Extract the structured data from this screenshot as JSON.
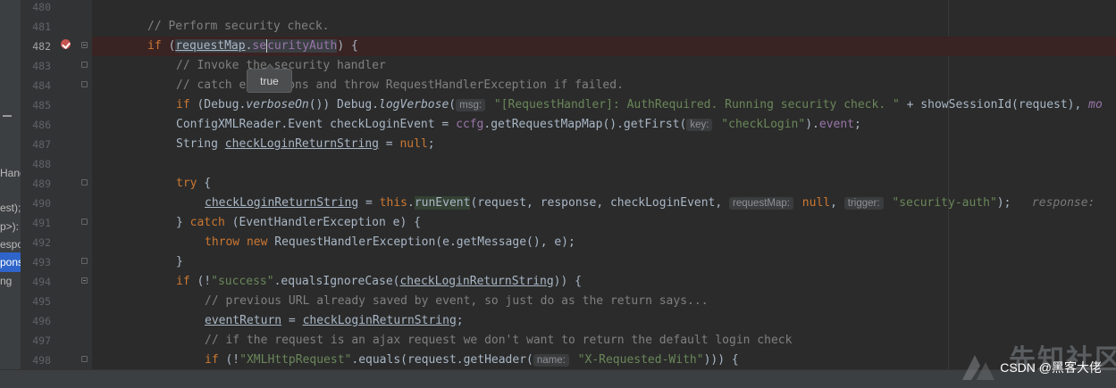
{
  "side_panel": {
    "items": [
      {
        "text": "Hand",
        "selected": false
      },
      {
        "text": "est);",
        "selected": false
      },
      {
        "text": "p>):",
        "selected": false
      },
      {
        "text": "espo",
        "selected": false
      },
      {
        "text": "pons",
        "selected": true
      },
      {
        "text": "ng",
        "selected": false
      }
    ]
  },
  "gutter": {
    "line_numbers": [
      "480",
      "481",
      "482",
      "483",
      "484",
      "485",
      "486",
      "487",
      "488",
      "489",
      "490",
      "491",
      "492",
      "493",
      "494",
      "495",
      "496",
      "497",
      "498"
    ],
    "current_line": "482",
    "breakpoint_line": "482",
    "breakpoint_icon": "breakpoint-verified-icon"
  },
  "code": {
    "l480": "",
    "l481": "// Perform security check.",
    "l482_kw": "if",
    "l482_a": " (",
    "l482_b": "requestMap",
    "l482_c": ".",
    "l482_d": "se",
    "l482_e": "curityAuth",
    "l482_f": ") {",
    "l483": "// Invoke the security handler",
    "l484": "// catch exceptions and throw RequestHandlerException if failed.",
    "l485_kw": "if",
    "l485_a": " (Debug.",
    "l485_fn": "verboseOn",
    "l485_b": "()) Debug.",
    "l485_fn2": "logVerbose",
    "l485_c": "(",
    "l485_hint": "msg:",
    "l485_str": " \"[RequestHandler]: AuthRequired. Running security check. \"",
    "l485_d": " + showSessionId(request), ",
    "l485_fld": "mo",
    "l486_a": "ConfigXMLReader.Event checkLoginEvent = ",
    "l486_fld": "ccfg",
    "l486_b": ".getRequestMapMap().getFirst(",
    "l486_hint": "key:",
    "l486_str": " \"checkLogin\"",
    "l486_c": ").",
    "l486_fld2": "event",
    "l486_d": ";",
    "l487_a": "String ",
    "l487_u": "checkLoginReturnString",
    "l487_b": " = ",
    "l487_kw": "null",
    "l487_c": ";",
    "l488": "",
    "l489_kw": "try",
    "l489_a": " {",
    "l490_u": "checkLoginReturnString",
    "l490_a": " = ",
    "l490_kw": "this",
    "l490_b": ".",
    "l490_box": "runEvent",
    "l490_c": "(request, response, checkLoginEvent, ",
    "l490_hint": "requestMap:",
    "l490_kw2": " null",
    "l490_d": ", ",
    "l490_hint2": "trigger:",
    "l490_str": " \"security-auth\"",
    "l490_e": ");",
    "l490_tail": "   response: ",
    "l491_a": "} ",
    "l491_kw": "catch",
    "l491_b": " (EventHandlerException e) {",
    "l492_kw": "throw new",
    "l492_a": " RequestHandlerException(e.getMessage(), e);",
    "l493": "}",
    "l494_kw": "if",
    "l494_a": " (!",
    "l494_str": "\"success\"",
    "l494_b": ".equalsIgnoreCase(",
    "l494_u": "checkLoginReturnString",
    "l494_c": ")) {",
    "l495": "// previous URL already saved by event, so just do as the return says...",
    "l496_u": "eventReturn",
    "l496_a": " = ",
    "l496_u2": "checkLoginReturnString",
    "l496_b": ";",
    "l497": "// if the request is an ajax request we don't want to return the default login check",
    "l498_kw": "if",
    "l498_a": " (!",
    "l498_str": "\"XMLHttpRequest\"",
    "l498_b": ".equals(request.getHeader(",
    "l498_hint": "name:",
    "l498_str2": " \"X-Requested-With\"",
    "l498_c": "))) {"
  },
  "tooltip": {
    "value": "true"
  },
  "watermark": {
    "text": "CSDN @黑客大佬",
    "bg_text": "先知社区",
    "logo_icon": "xianzhi-logo-icon"
  },
  "colors": {
    "background": "#2b2b2b",
    "keyword": "#cc7832",
    "string": "#6a8759",
    "comment": "#808080",
    "field": "#9876aa",
    "text": "#a9b7c6",
    "breakpoint": "#c75450",
    "selection": "#2f65ca"
  }
}
